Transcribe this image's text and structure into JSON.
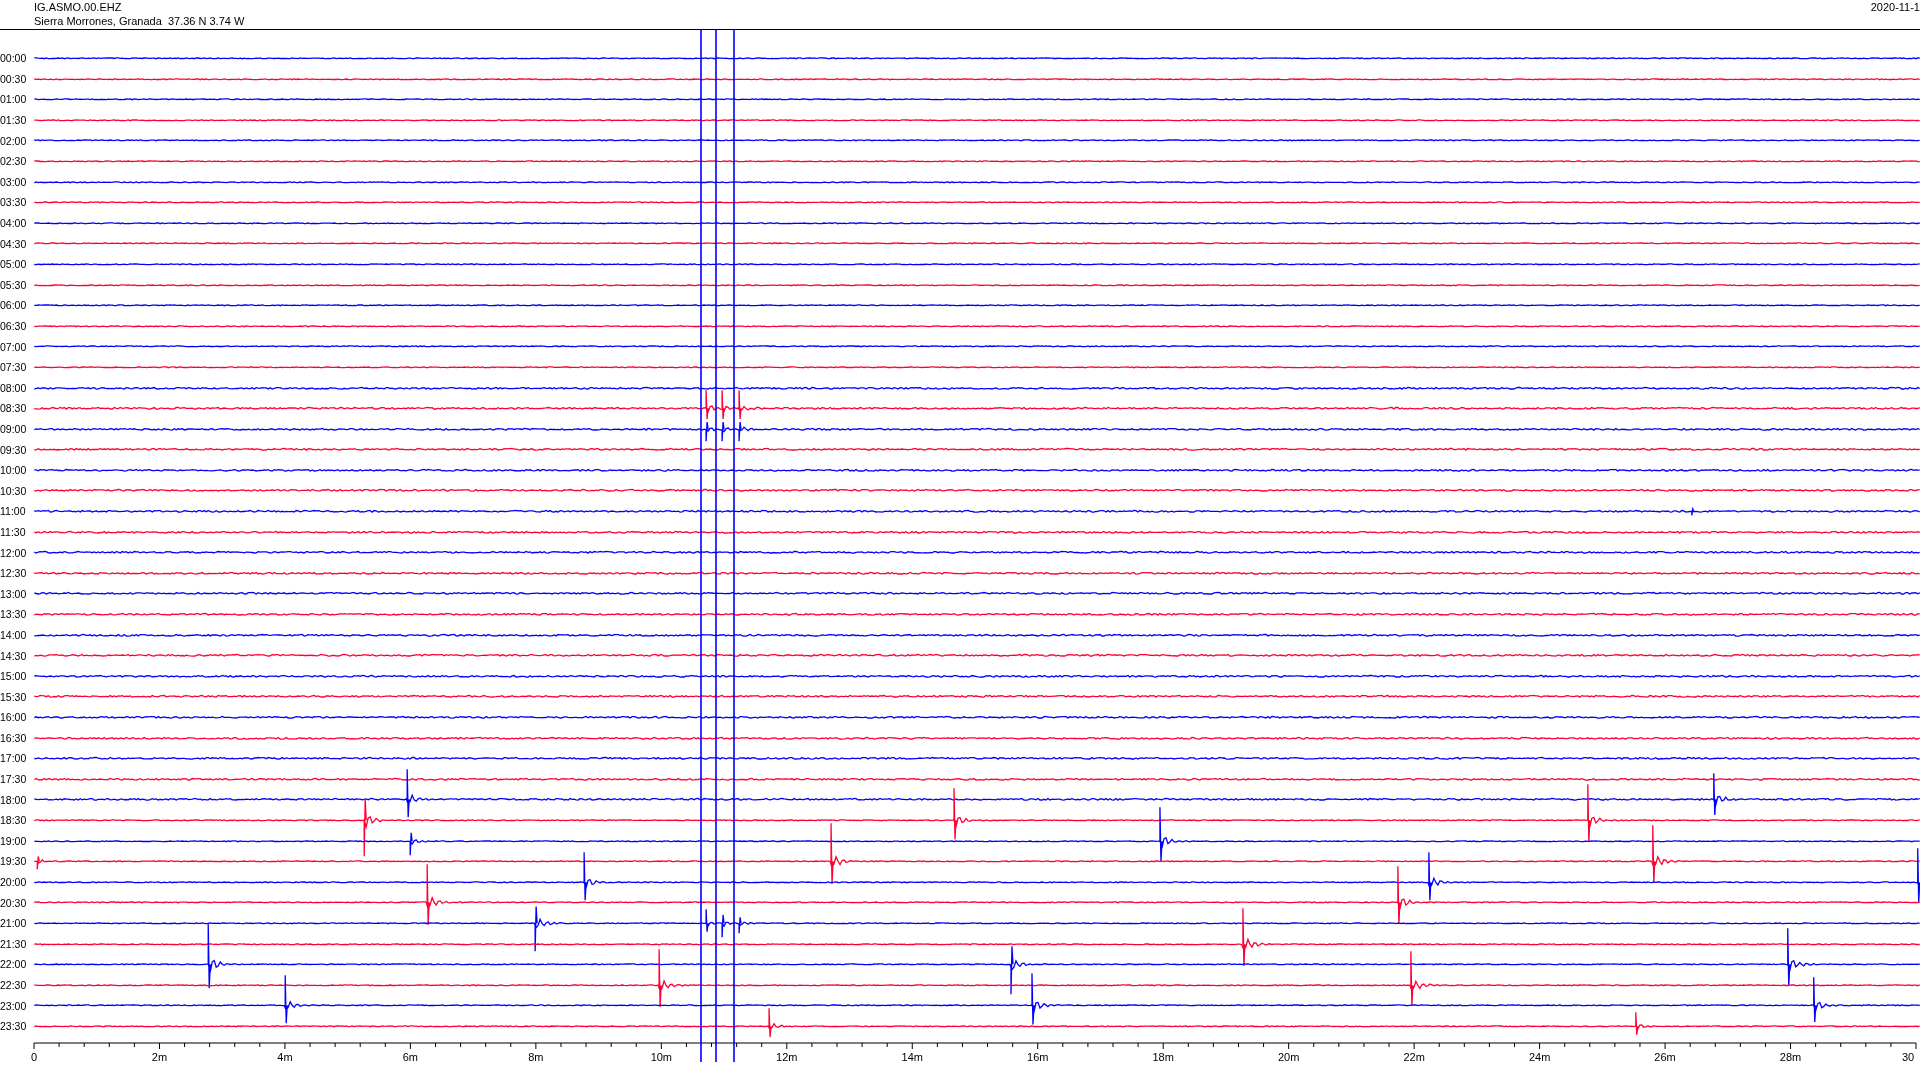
{
  "header": {
    "station": "IG.ASMO.00.EHZ",
    "location": "Sierra Morrones, Granada  37.36 N 3.74 W",
    "date": "2020-11-1"
  },
  "traces": [
    {
      "time": "00:00",
      "color": "#0000ff"
    },
    {
      "time": "00:30",
      "color": "#ff0033"
    },
    {
      "time": "01:00",
      "color": "#0000ff"
    },
    {
      "time": "01:30",
      "color": "#ff0033"
    },
    {
      "time": "02:00",
      "color": "#0000ff"
    },
    {
      "time": "02:30",
      "color": "#ff0033"
    },
    {
      "time": "03:00",
      "color": "#0000ff"
    },
    {
      "time": "03:30",
      "color": "#ff0033"
    },
    {
      "time": "04:00",
      "color": "#0000ff"
    },
    {
      "time": "04:30",
      "color": "#ff0033"
    },
    {
      "time": "05:00",
      "color": "#0000ff"
    },
    {
      "time": "05:30",
      "color": "#ff0033"
    },
    {
      "time": "06:00",
      "color": "#0000ff"
    },
    {
      "time": "06:30",
      "color": "#ff0033"
    },
    {
      "time": "07:00",
      "color": "#0000ff"
    },
    {
      "time": "07:30",
      "color": "#ff0033"
    },
    {
      "time": "08:00",
      "color": "#0000ff"
    },
    {
      "time": "08:30",
      "color": "#ff0033"
    },
    {
      "time": "09:00",
      "color": "#0000ff"
    },
    {
      "time": "09:30",
      "color": "#ff0033"
    },
    {
      "time": "10:00",
      "color": "#0000ff"
    },
    {
      "time": "10:30",
      "color": "#ff0033"
    },
    {
      "time": "11:00",
      "color": "#0000ff"
    },
    {
      "time": "11:30",
      "color": "#ff0033"
    },
    {
      "time": "12:00",
      "color": "#0000ff"
    },
    {
      "time": "12:30",
      "color": "#ff0033"
    },
    {
      "time": "13:00",
      "color": "#0000ff"
    },
    {
      "time": "13:30",
      "color": "#ff0033"
    },
    {
      "time": "14:00",
      "color": "#0000ff"
    },
    {
      "time": "14:30",
      "color": "#ff0033"
    },
    {
      "time": "15:00",
      "color": "#0000ff"
    },
    {
      "time": "15:30",
      "color": "#ff0033"
    },
    {
      "time": "16:00",
      "color": "#0000ff"
    },
    {
      "time": "16:30",
      "color": "#ff0033"
    },
    {
      "time": "17:00",
      "color": "#0000ff"
    },
    {
      "time": "17:30",
      "color": "#ff0033"
    },
    {
      "time": "18:00",
      "color": "#0000ff"
    },
    {
      "time": "18:30",
      "color": "#ff0033"
    },
    {
      "time": "19:00",
      "color": "#0000ff"
    },
    {
      "time": "19:30",
      "color": "#ff0033"
    },
    {
      "time": "20:00",
      "color": "#0000ff"
    },
    {
      "time": "20:30",
      "color": "#ff0033"
    },
    {
      "time": "21:00",
      "color": "#0000ff"
    },
    {
      "time": "21:30",
      "color": "#ff0033"
    },
    {
      "time": "22:00",
      "color": "#0000ff"
    },
    {
      "time": "22:30",
      "color": "#ff0033"
    },
    {
      "time": "23:00",
      "color": "#0000ff"
    },
    {
      "time": "23:30",
      "color": "#ff0033"
    }
  ],
  "x_axis": {
    "tick_labels": [
      "0",
      "2m",
      "4m",
      "6m",
      "8m",
      "10m",
      "12m",
      "14m",
      "16m",
      "18m",
      "20m",
      "22m",
      "24m",
      "26m",
      "28m",
      "30"
    ]
  }
}
